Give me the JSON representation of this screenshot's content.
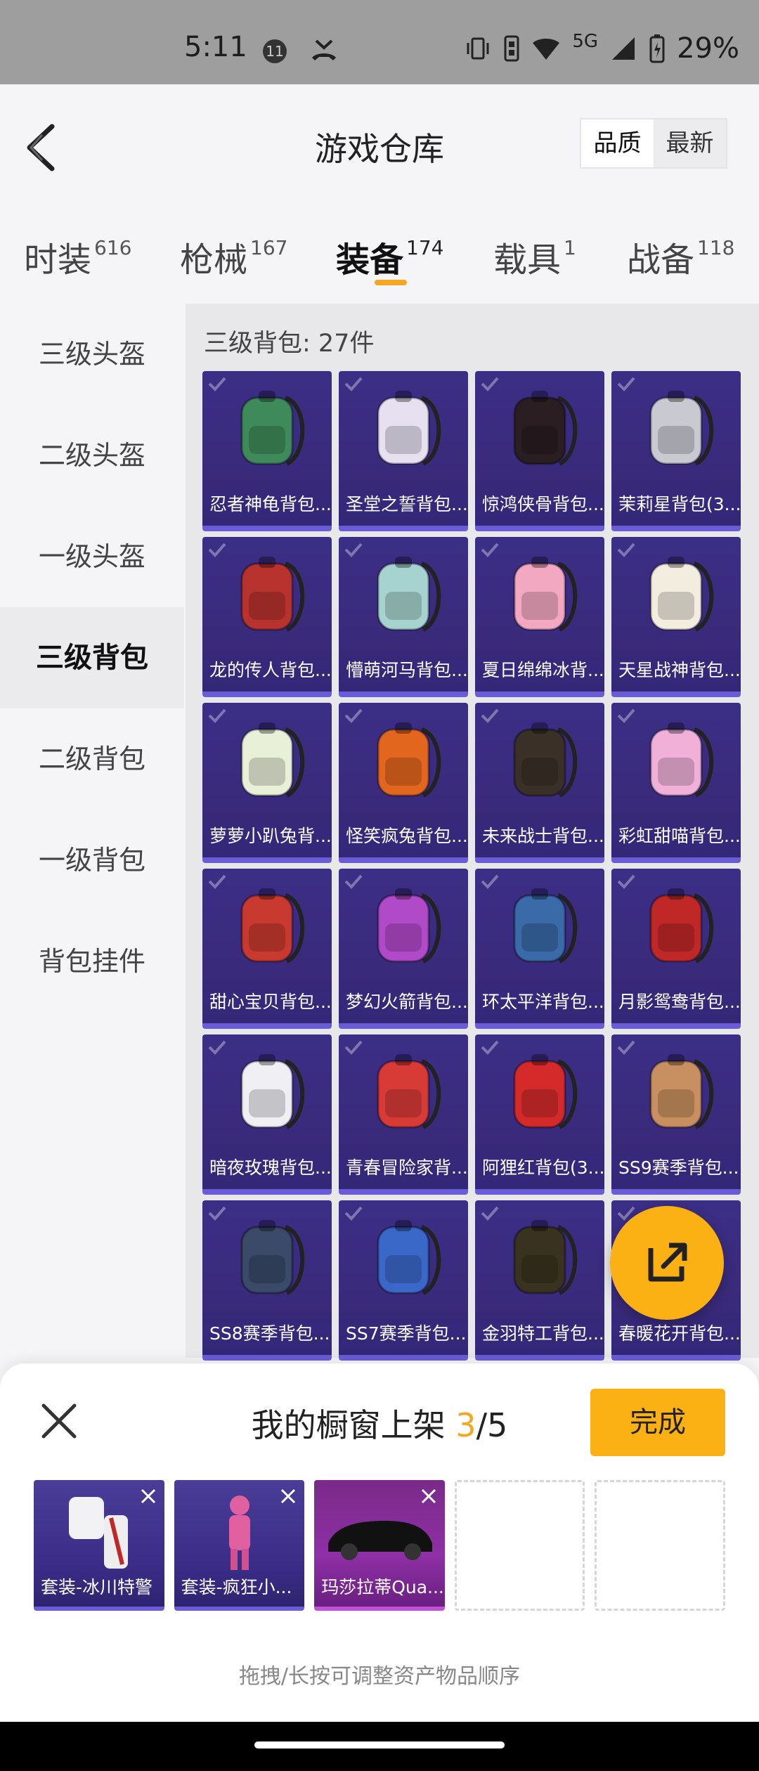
{
  "status_bar": {
    "time": "5:11",
    "notification_count": "11",
    "network": "5G",
    "battery": "29%"
  },
  "header": {
    "title": "游戏仓库",
    "sort_options": [
      "品质",
      "最新"
    ],
    "sort_selected": "品质"
  },
  "category_tabs": [
    {
      "label": "时装",
      "count": "616"
    },
    {
      "label": "枪械",
      "count": "167"
    },
    {
      "label": "装备",
      "count": "174",
      "active": true
    },
    {
      "label": "载具",
      "count": "1"
    },
    {
      "label": "战备",
      "count": "118"
    }
  ],
  "sidebar": {
    "items": [
      "三级头盔",
      "二级头盔",
      "一级头盔",
      "三级背包",
      "二级背包",
      "一级背包",
      "背包挂件"
    ],
    "active": "三级背包"
  },
  "section": {
    "title": "三级背包: 27件"
  },
  "items": [
    {
      "name": "忍者神龟背包...",
      "icon": "turtle-backpack-icon",
      "color": "#3f8a5a"
    },
    {
      "name": "圣堂之誓背包...",
      "icon": "angel-backpack-icon",
      "color": "#e6e0f0"
    },
    {
      "name": "惊鸿侠骨背包...",
      "icon": "dark-backpack-icon",
      "color": "#2a1e22"
    },
    {
      "name": "茉莉星背包(3...",
      "icon": "silver-backpack-icon",
      "color": "#c9c9d2"
    },
    {
      "name": "龙的传人背包...",
      "icon": "red-backpack-icon",
      "color": "#b8322e"
    },
    {
      "name": "懵萌河马背包...",
      "icon": "hippo-backpack-icon",
      "color": "#a6d3cf"
    },
    {
      "name": "夏日绵绵冰背...",
      "icon": "icecream-backpack-icon",
      "color": "#f2a8c0"
    },
    {
      "name": "天星战神背包...",
      "icon": "white-gold-backpack-icon",
      "color": "#f3ede0"
    },
    {
      "name": "萝萝小趴兔背...",
      "icon": "bunny-backpack-icon",
      "color": "#e8f0d8"
    },
    {
      "name": "怪笑疯兔背包...",
      "icon": "crazy-rabbit-backpack-icon",
      "color": "#e2661e"
    },
    {
      "name": "未来战士背包...",
      "icon": "tactical-backpack-icon",
      "color": "#3a3028"
    },
    {
      "name": "彩虹甜喵背包...",
      "icon": "rainbow-cat-backpack-icon",
      "color": "#f0b0d8"
    },
    {
      "name": "甜心宝贝背包...",
      "icon": "cake-backpack-icon",
      "color": "#c83a30"
    },
    {
      "name": "梦幻火箭背包...",
      "icon": "rocket-backpack-icon",
      "color": "#b04ac8"
    },
    {
      "name": "环太平洋背包...",
      "icon": "mech-backpack-icon",
      "color": "#3a6aa8"
    },
    {
      "name": "月影鸳鸯背包...",
      "icon": "phoenix-backpack-icon",
      "color": "#c02828"
    },
    {
      "name": "暗夜玫瑰背包...",
      "icon": "plush-backpack-icon",
      "color": "#f0f0f4"
    },
    {
      "name": "青春冒险家背...",
      "icon": "red-dino-backpack-icon",
      "color": "#d83a36"
    },
    {
      "name": "阿狸红背包(3...",
      "icon": "fox-backpack-icon",
      "color": "#d42a2a"
    },
    {
      "name": "SS9赛季背包...",
      "icon": "ss9-backpack-icon",
      "color": "#c89060"
    },
    {
      "name": "SS8赛季背包...",
      "icon": "ss8-backpack-icon",
      "color": "#3a4a68"
    },
    {
      "name": "SS7赛季背包...",
      "icon": "ss7-backpack-icon",
      "color": "#3a68c8"
    },
    {
      "name": "金羽特工背包...",
      "icon": "gold-feather-backpack-icon",
      "color": "#3a3220"
    },
    {
      "name": "春暖花开背包...",
      "icon": "spring-backpack-icon",
      "color": "#e8a8c0"
    }
  ],
  "showcase": {
    "title": "我的橱窗上架",
    "count_current": "3",
    "count_total": "/5",
    "done_label": "完成",
    "slots": [
      {
        "name": "套装-冰川特警",
        "icon": "white-suit-icon",
        "style": "filled"
      },
      {
        "name": "套装-疯狂小...",
        "icon": "pink-bunny-suit-icon",
        "style": "filled"
      },
      {
        "name": "玛莎拉蒂Qua...",
        "icon": "black-car-icon",
        "style": "pink"
      },
      {
        "name": "",
        "style": "empty"
      },
      {
        "name": "",
        "style": "empty"
      }
    ],
    "hint": "拖拽/长按可调整资产物品顺序"
  },
  "colors": {
    "accent": "#fbb013",
    "card_purple": "#3b2e86"
  }
}
